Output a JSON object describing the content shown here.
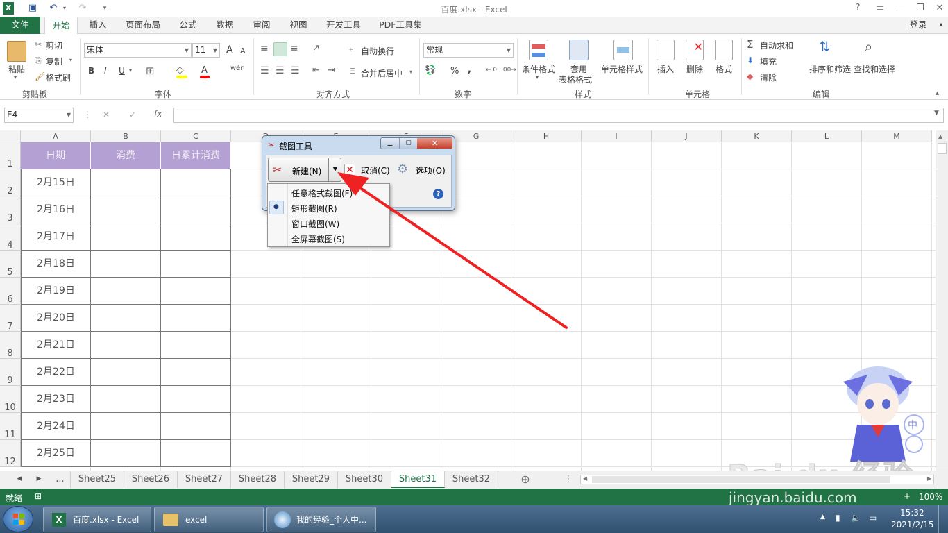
{
  "window": {
    "title": "百度.xlsx - Excel",
    "login": "登录",
    "help": "?"
  },
  "tabs": [
    "文件",
    "开始",
    "插入",
    "页面布局",
    "公式",
    "数据",
    "审阅",
    "视图",
    "开发工具",
    "PDF工具集"
  ],
  "ribbon": {
    "clipboard": {
      "group": "剪贴板",
      "paste": "粘贴",
      "cut": "剪切",
      "copy": "复制",
      "format_painter": "格式刷"
    },
    "font": {
      "group": "字体",
      "name": "宋体",
      "size": "11",
      "grow": "A",
      "shrink": "A",
      "bold": "B",
      "italic": "I",
      "underline": "U",
      "phonetic": "wén"
    },
    "alignment": {
      "group": "对齐方式",
      "wrap": "自动换行",
      "merge": "合并后居中"
    },
    "number": {
      "group": "数字",
      "format": "常规",
      "percent": "%",
      "comma": ","
    },
    "styles": {
      "group": "样式",
      "conditional": "条件格式",
      "table1": "套用",
      "table2": "表格格式",
      "cell_styles": "单元格样式"
    },
    "cells": {
      "group": "单元格",
      "insert": "插入",
      "delete": "删除",
      "format": "格式"
    },
    "editing": {
      "group": "编辑",
      "autosum": "自动求和",
      "fill": "填充",
      "clear": "清除",
      "sort": "排序和筛选",
      "find": "查找和选择"
    }
  },
  "formula_bar": {
    "name_box": "E4",
    "fx": "fx",
    "cancel": "✕",
    "enter": "✓",
    "value": ""
  },
  "grid": {
    "columns": [
      "A",
      "B",
      "C",
      "D",
      "E",
      "F",
      "G",
      "H",
      "I",
      "J",
      "K",
      "L",
      "M"
    ],
    "rows": [
      "1",
      "2",
      "3",
      "4",
      "5",
      "6",
      "7",
      "8",
      "9",
      "10",
      "11",
      "12"
    ],
    "headers": [
      "日期",
      "消费",
      "日累计消费"
    ],
    "dates": [
      "2月15日",
      "2月16日",
      "2月17日",
      "2月18日",
      "2月19日",
      "2月20日",
      "2月21日",
      "2月22日",
      "2月23日",
      "2月24日",
      "2月25日"
    ],
    "header_bg": "#b4a0d2"
  },
  "sheets": {
    "more": "...",
    "tabs": [
      "Sheet25",
      "Sheet26",
      "Sheet27",
      "Sheet28",
      "Sheet29",
      "Sheet30",
      "Sheet31",
      "Sheet32"
    ],
    "active": "Sheet31",
    "add": "⊕"
  },
  "status": {
    "ready": "就绪",
    "zoom": "100%",
    "zoom_minus": "−",
    "zoom_plus": "+"
  },
  "watermark": {
    "logo": "Bai du 经验",
    "url": "jingyan.baidu.com"
  },
  "snipping_tool": {
    "title": "截图工具",
    "new": "新建(N)",
    "cancel": "取消(C)",
    "options": "选项(O)",
    "menu": [
      "任意格式截图(F)",
      "矩形截图(R)",
      "窗口截图(W)",
      "全屏幕截图(S)"
    ],
    "selected_index": 1
  },
  "taskbar": {
    "items": [
      "百度.xlsx - Excel",
      "excel",
      "我的经验_个人中..."
    ],
    "time": "15:32",
    "date": "2021/2/15"
  },
  "colors": {
    "excel_green": "#217346",
    "arrow_red": "#ee2222"
  }
}
